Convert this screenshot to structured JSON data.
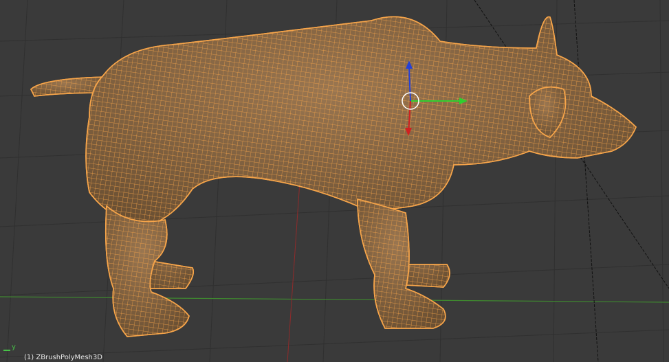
{
  "viewport": {
    "object_label": "(1) ZBrushPolyMesh3D",
    "axis_label": "y"
  },
  "colors": {
    "background": "#3a3a3a",
    "grid": "#303030",
    "x_axis": "#8f2b2b",
    "y_axis": "#3f8a2f",
    "wire": "#f7a54a",
    "surface": "#8c6a45",
    "gizmo_x": "#d12020",
    "gizmo_y": "#2fcf2f",
    "gizmo_z": "#2440d8"
  },
  "icons": {
    "object": "mesh-object-dog",
    "gizmo": "transform-gizmo",
    "origin": "3d-cursor-icon"
  }
}
